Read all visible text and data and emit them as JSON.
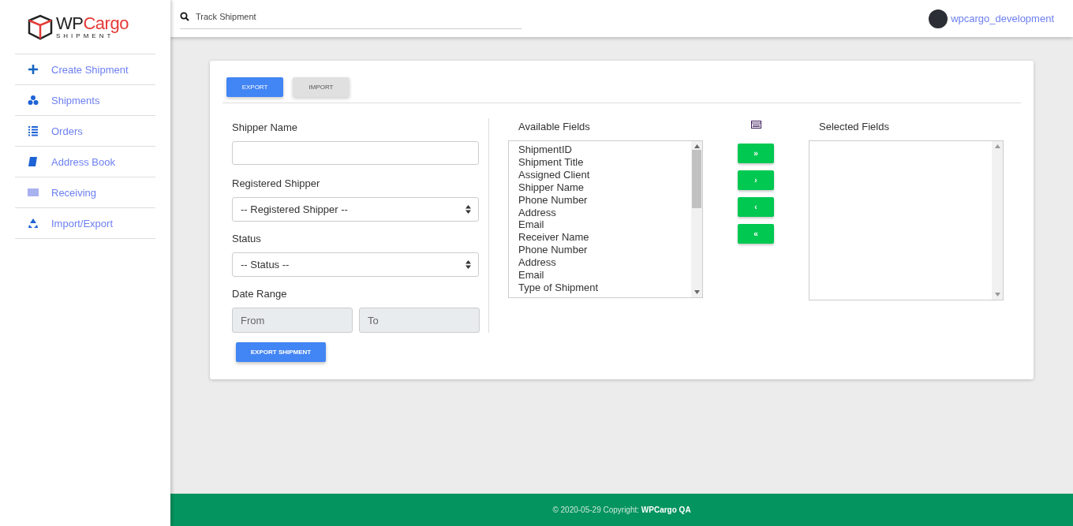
{
  "logo": {
    "prefix": "WP",
    "main": "Cargo",
    "sub": "SHIPMENT"
  },
  "sidebar": {
    "items": [
      {
        "label": "Create Shipment"
      },
      {
        "label": "Shipments"
      },
      {
        "label": "Orders"
      },
      {
        "label": "Address Book"
      },
      {
        "label": "Receiving"
      },
      {
        "label": "Import/Export"
      }
    ]
  },
  "search": {
    "placeholder": "Track Shipment"
  },
  "user": {
    "name": "wpcargo_development"
  },
  "tabs": [
    {
      "label": "EXPORT",
      "selected": true
    },
    {
      "label": "IMPORT",
      "selected": false
    }
  ],
  "form": {
    "shipper_name": {
      "label": "Shipper Name"
    },
    "registered_shipper": {
      "label": "Registered Shipper",
      "value": "-- Registered Shipper --"
    },
    "status": {
      "label": "Status",
      "value": "-- Status --"
    },
    "date_range": {
      "label": "Date Range",
      "from_placeholder": "From",
      "to_placeholder": "To"
    },
    "submit": "EXPORT SHIPMENT"
  },
  "available_fields": {
    "label": "Available Fields",
    "items": [
      "ShipmentID",
      "Shipment Title",
      "Assigned Client",
      "Shipper Name",
      "Phone Number",
      "Address",
      "Email",
      "Receiver Name",
      "Phone Number",
      "Address",
      "Email",
      "Type of Shipment"
    ]
  },
  "move_buttons": [
    "»",
    "›",
    "‹",
    "«"
  ],
  "selected_fields": {
    "label": "Selected Fields"
  },
  "footer": "© 2020-05-29 Copyright: **WPCargo QA**"
}
